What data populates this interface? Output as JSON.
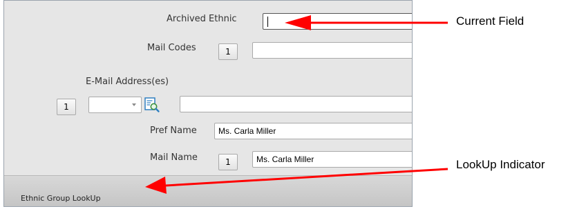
{
  "form": {
    "archived_ethnic_label": "Archived Ethnic",
    "mail_codes_label": "Mail Codes",
    "mail_codes_index": "1",
    "email_section_label": "E-Mail Address(es)",
    "email_index": "1",
    "pref_name_label": "Pref Name",
    "pref_name_value": "Ms. Carla Miller",
    "mail_name_label": "Mail Name",
    "mail_name_index": "1",
    "mail_name_value": "Ms. Carla Miller"
  },
  "status_bar": {
    "text": "Ethnic Group LookUp"
  },
  "annotations": {
    "current_field": "Current Field",
    "lookup_indicator": "LookUp Indicator"
  },
  "colors": {
    "arrow": "#ff0000",
    "window_bg": "#e6e6e6"
  }
}
